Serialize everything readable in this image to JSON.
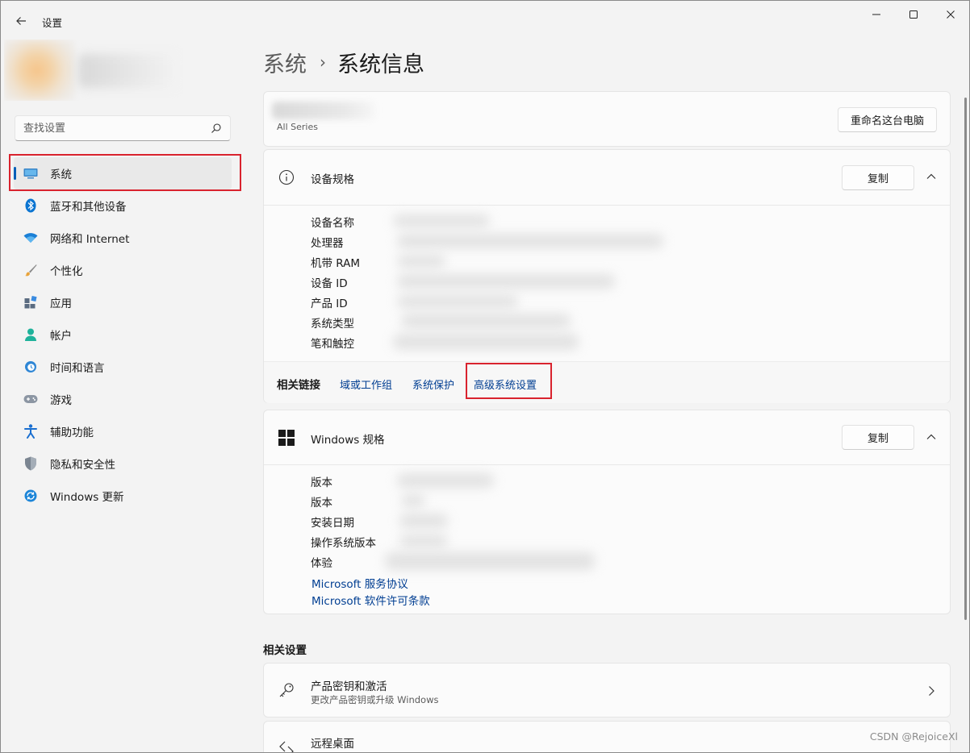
{
  "window": {
    "title": "设置",
    "controls": {
      "minimize": "minimize",
      "maximize": "maximize",
      "close": "close"
    }
  },
  "search": {
    "placeholder": "查找设置"
  },
  "sidebar": {
    "items": [
      {
        "label": "系统",
        "icon": "system-icon",
        "selected": true
      },
      {
        "label": "蓝牙和其他设备",
        "icon": "bluetooth-icon"
      },
      {
        "label": "网络和 Internet",
        "icon": "wifi-icon"
      },
      {
        "label": "个性化",
        "icon": "brush-icon"
      },
      {
        "label": "应用",
        "icon": "apps-icon"
      },
      {
        "label": "帐户",
        "icon": "account-icon"
      },
      {
        "label": "时间和语言",
        "icon": "time-language-icon"
      },
      {
        "label": "游戏",
        "icon": "gamepad-icon"
      },
      {
        "label": "辅助功能",
        "icon": "accessibility-icon"
      },
      {
        "label": "隐私和安全性",
        "icon": "shield-icon"
      },
      {
        "label": "Windows 更新",
        "icon": "windows-update-icon"
      }
    ]
  },
  "breadcrumb": {
    "parent": "系统",
    "separator": "›",
    "current": "系统信息"
  },
  "pc_card": {
    "series": "All Series",
    "rename_button": "重命名这台电脑"
  },
  "device_specs": {
    "title": "设备规格",
    "copy_button": "复制",
    "labels": [
      "设备名称",
      "处理器",
      "机带 RAM",
      "设备 ID",
      "产品 ID",
      "系统类型",
      "笔和触控"
    ]
  },
  "related_links": {
    "title": "相关链接",
    "links": [
      "域或工作组",
      "系统保护",
      "高级系统设置"
    ]
  },
  "windows_specs": {
    "title": "Windows 规格",
    "copy_button": "复制",
    "labels": [
      "版本",
      "版本",
      "安装日期",
      "操作系统版本",
      "体验"
    ],
    "links": [
      "Microsoft 服务协议",
      "Microsoft 软件许可条款"
    ]
  },
  "related_settings": {
    "title": "相关设置",
    "items": [
      {
        "title": "产品密钥和激活",
        "subtitle": "更改产品密钥或升级 Windows",
        "icon": "key-icon"
      },
      {
        "title": "远程桌面",
        "subtitle": "",
        "icon": "remote-desktop-icon"
      }
    ]
  },
  "watermark": "CSDN @RejoiceXl",
  "colors": {
    "accent": "#005fb8",
    "link": "#003e92",
    "highlight_box": "#d9232e"
  }
}
